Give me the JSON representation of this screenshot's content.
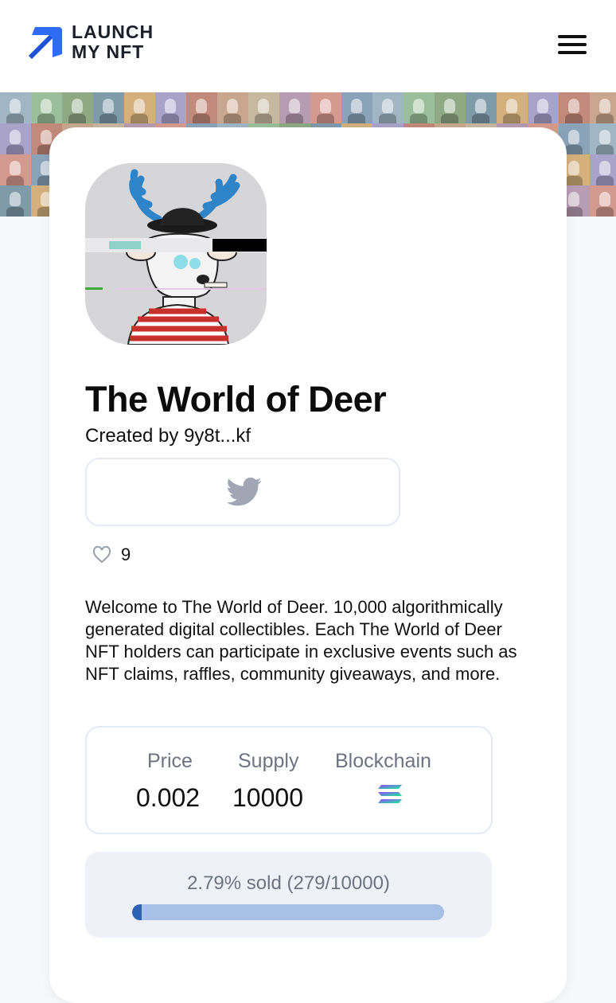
{
  "brand": {
    "line1": "LAUNCH",
    "line2": "MY NFT",
    "color": "#2f6cf6"
  },
  "header": {
    "menu_icon": "hamburger-menu-icon"
  },
  "collection": {
    "title": "The World of Deer",
    "created_by": "Created by 9y8t...kf",
    "likes": "9",
    "description": "Welcome to The World of Deer. 10,000 algorithmically generated digital collectibles. Each The World of Deer NFT holders can participate in exclusive events such as NFT claims, raffles, community giveaways, and more."
  },
  "social": {
    "twitter_icon": "twitter-icon",
    "icon_color": "#a0a6b3"
  },
  "stats": {
    "price_label": "Price",
    "price_value": "0.002",
    "supply_label": "Supply",
    "supply_value": "10000",
    "blockchain_label": "Blockchain",
    "blockchain_icon": "solana-icon"
  },
  "progress": {
    "text": "2.79% sold (279/10000)",
    "fraction": 0.0279,
    "track_color": "#a7c0e6",
    "fill_color": "#2c61b8"
  }
}
